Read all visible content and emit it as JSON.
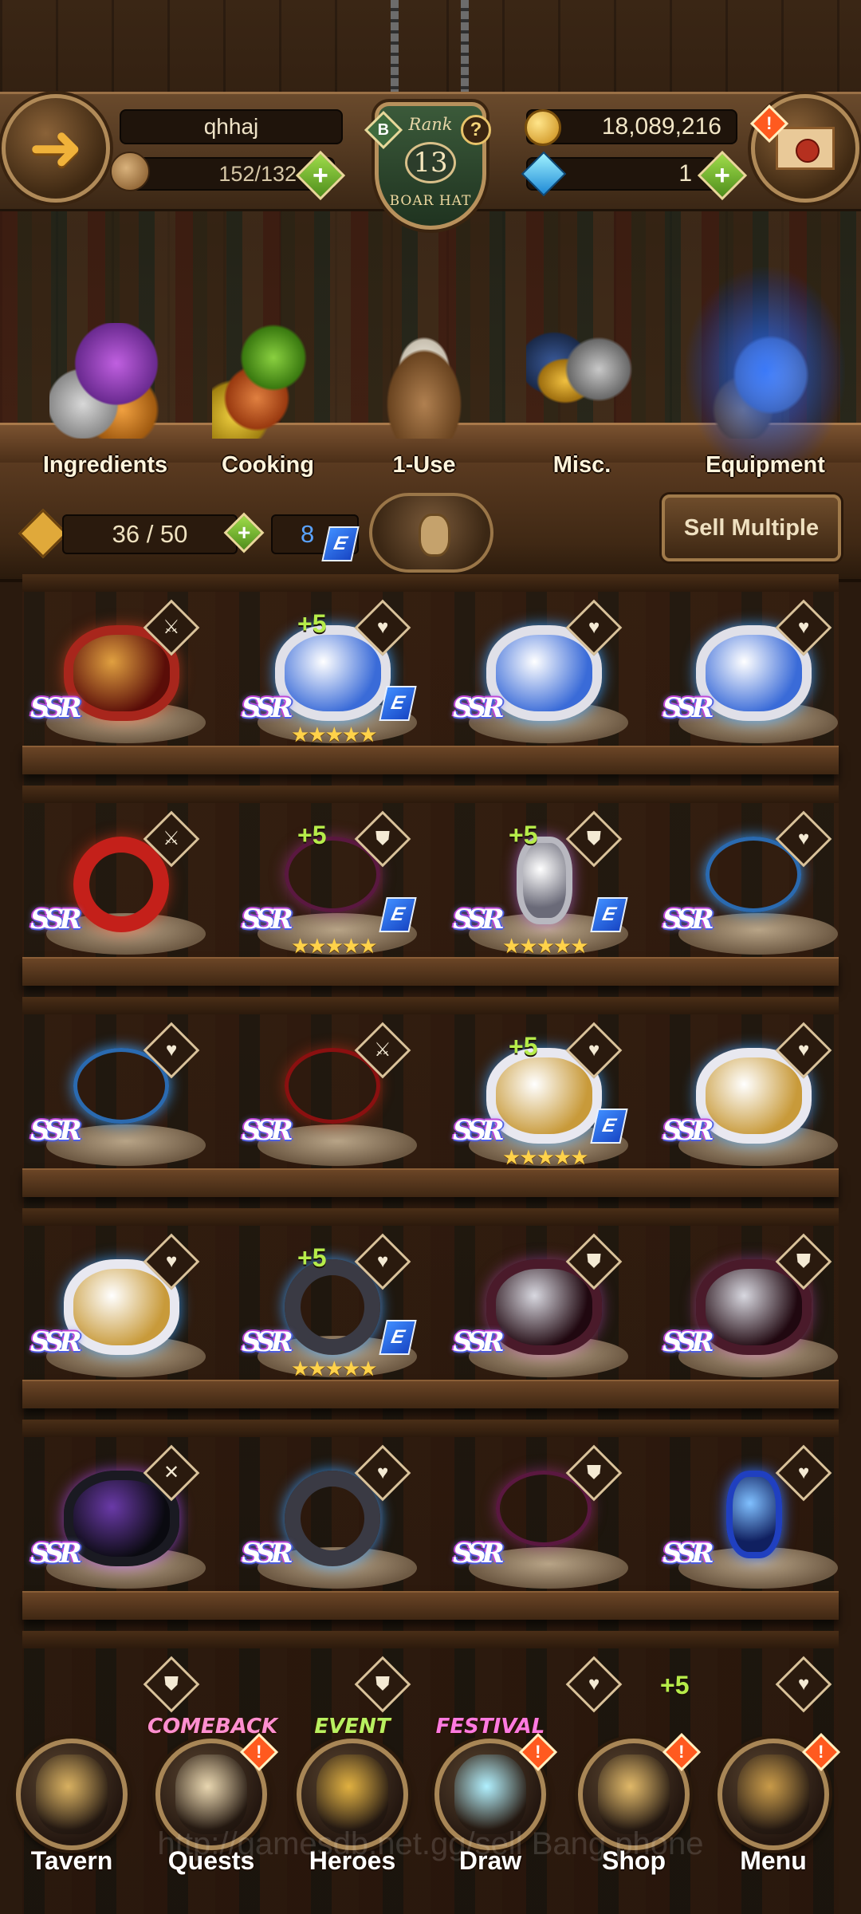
{
  "hud": {
    "player_name": "qhhaj",
    "stamina": "152/132",
    "rank_label": "Rank",
    "rank_number": "13",
    "rank_title": "BOAR HAT",
    "rank_badge_letter": "B",
    "help_symbol": "?",
    "gold": "18,089,216",
    "gems": "1",
    "alert_symbol": "!"
  },
  "categories": [
    {
      "label": "Ingredients",
      "icon": "ingredients-icon",
      "active": false
    },
    {
      "label": "Cooking",
      "icon": "cooking-icon",
      "active": false
    },
    {
      "label": "1-Use",
      "icon": "one-use-bag-icon",
      "active": false
    },
    {
      "label": "Misc.",
      "icon": "misc-trophy-icon",
      "active": false
    },
    {
      "label": "Equipment",
      "icon": "equipment-armor-icon",
      "active": true
    }
  ],
  "inventory": {
    "count": "36 / 50",
    "equipped_count": "8",
    "equipped_tag": "E",
    "sell_label": "Sell Multiple"
  },
  "items": [
    {
      "rarity": "SSR",
      "lock": "sword",
      "plus": "",
      "stars": "",
      "equipped": false,
      "kind": "bracelet",
      "c1": "#a8261c",
      "c2": "#e0a040",
      "c3": "#5a0d08",
      "glow": "rgba(255,80,40,0.5)"
    },
    {
      "rarity": "SSR",
      "lock": "heart",
      "plus": "+5",
      "stars": "★★★★★",
      "equipped": true,
      "kind": "bracelet",
      "c1": "#e0e0e8",
      "c2": "#ffffff",
      "c3": "#3a6bd8",
      "glow": "rgba(60,160,255,0.9)"
    },
    {
      "rarity": "SSR",
      "lock": "heart",
      "plus": "",
      "stars": "",
      "equipped": false,
      "kind": "bracelet",
      "c1": "#e0e0e8",
      "c2": "#ffffff",
      "c3": "#3a6bd8",
      "glow": "rgba(60,160,255,0.9)"
    },
    {
      "rarity": "SSR",
      "lock": "heart",
      "plus": "",
      "stars": "",
      "equipped": false,
      "kind": "bracelet",
      "c1": "#e0e0e8",
      "c2": "#ffffff",
      "c3": "#3a6bd8",
      "glow": "rgba(60,160,255,0.9)"
    },
    {
      "rarity": "SSR",
      "lock": "sword",
      "plus": "",
      "stars": "",
      "equipped": false,
      "kind": "ring",
      "c1": "#c4201a",
      "c2": "#ffcc40",
      "c3": "#200000",
      "glow": "rgba(255,60,30,0.5)"
    },
    {
      "rarity": "SSR",
      "lock": "shield",
      "plus": "+5",
      "stars": "★★★★★",
      "equipped": true,
      "kind": "necklace",
      "c1": "#5a1840",
      "c2": "#c0c0c8",
      "c3": "#5a1840",
      "glow": "rgba(180,60,160,0.5)"
    },
    {
      "rarity": "SSR",
      "lock": "shield",
      "plus": "+5",
      "stars": "★★★★★",
      "equipped": true,
      "kind": "earring",
      "c1": "#b8b8c0",
      "c2": "#ffffff",
      "c3": "#6a6a78",
      "glow": "rgba(200,120,255,0.6)"
    },
    {
      "rarity": "SSR",
      "lock": "heart",
      "plus": "",
      "stars": "",
      "equipped": false,
      "kind": "necklace",
      "c1": "#2a6ab0",
      "c2": "#ffd060",
      "c3": "#2a6ab0",
      "glow": "rgba(60,160,255,0.9)"
    },
    {
      "rarity": "SSR",
      "lock": "heart",
      "plus": "",
      "stars": "",
      "equipped": false,
      "kind": "necklace",
      "c1": "#2a6ab0",
      "c2": "#ffd060",
      "c3": "#2a6ab0",
      "glow": "rgba(60,160,255,0.9)"
    },
    {
      "rarity": "SSR",
      "lock": "sword",
      "plus": "",
      "stars": "",
      "equipped": false,
      "kind": "necklace",
      "c1": "#8a1010",
      "c2": "#ffb030",
      "c3": "#8a1010",
      "glow": "rgba(255,60,30,0.4)"
    },
    {
      "rarity": "SSR",
      "lock": "heart",
      "plus": "+5",
      "stars": "★★★★★",
      "equipped": true,
      "kind": "bracelet",
      "c1": "#e8e8f0",
      "c2": "#ffffff",
      "c3": "#c89a3a",
      "glow": "rgba(60,160,255,0.8)"
    },
    {
      "rarity": "SSR",
      "lock": "heart",
      "plus": "",
      "stars": "",
      "equipped": false,
      "kind": "bracelet",
      "c1": "#e8e8f0",
      "c2": "#ffffff",
      "c3": "#c89a3a",
      "glow": "rgba(60,160,255,0.8)"
    },
    {
      "rarity": "SSR",
      "lock": "heart",
      "plus": "",
      "stars": "",
      "equipped": false,
      "kind": "bracelet",
      "c1": "#e8e8f0",
      "c2": "#ffffff",
      "c3": "#c89a3a",
      "glow": "rgba(60,160,255,0.8)"
    },
    {
      "rarity": "SSR",
      "lock": "heart",
      "plus": "+5",
      "stars": "★★★★★",
      "equipped": true,
      "kind": "ring",
      "c1": "#3a3a44",
      "c2": "#3070ff",
      "c3": "#101018",
      "glow": "rgba(60,160,255,0.9)"
    },
    {
      "rarity": "SSR",
      "lock": "shield",
      "plus": "",
      "stars": "",
      "equipped": false,
      "kind": "bracelet",
      "c1": "#4a1a2a",
      "c2": "#d8d8e0",
      "c3": "#200810",
      "glow": "rgba(200,80,200,0.5)"
    },
    {
      "rarity": "SSR",
      "lock": "shield",
      "plus": "",
      "stars": "",
      "equipped": false,
      "kind": "bracelet",
      "c1": "#4a1a2a",
      "c2": "#d8d8e0",
      "c3": "#200810",
      "glow": "rgba(200,80,200,0.5)"
    },
    {
      "rarity": "SSR",
      "lock": "cross",
      "plus": "",
      "stars": "",
      "equipped": false,
      "kind": "bracelet",
      "c1": "#1a1a22",
      "c2": "#6a3aa8",
      "c3": "#0a0a10",
      "glow": "rgba(180,80,255,0.7)"
    },
    {
      "rarity": "SSR",
      "lock": "heart",
      "plus": "",
      "stars": "",
      "equipped": false,
      "kind": "ring",
      "c1": "#3a3a44",
      "c2": "#3070ff",
      "c3": "#101018",
      "glow": "rgba(60,160,255,0.9)"
    },
    {
      "rarity": "SSR",
      "lock": "shield",
      "plus": "",
      "stars": "",
      "equipped": false,
      "kind": "necklace",
      "c1": "#5a1840",
      "c2": "#c0c0c8",
      "c3": "#5a1840",
      "glow": "rgba(180,60,160,0.5)"
    },
    {
      "rarity": "SSR",
      "lock": "heart",
      "plus": "",
      "stars": "",
      "equipped": false,
      "kind": "earring",
      "c1": "#2040c0",
      "c2": "#80c0ff",
      "c3": "#102060",
      "glow": "rgba(60,120,255,0.9)"
    }
  ],
  "partial_row": [
    {
      "lock": "shield",
      "plus": ""
    },
    {
      "lock": "shield",
      "plus": ""
    },
    {
      "lock": "heart",
      "plus": ""
    },
    {
      "lock": "heart",
      "plus": "+5"
    }
  ],
  "nav": [
    {
      "label": "Tavern",
      "banner": "",
      "icon": "tavern-pig-icon",
      "alert": false,
      "color": "#d8b060"
    },
    {
      "label": "Quests",
      "banner": "COMEBACK",
      "icon": "quest-scroll-icon",
      "alert": true,
      "color": "#e8d6b0"
    },
    {
      "label": "Heroes",
      "banner": "EVENT",
      "icon": "hero-helmet-icon",
      "alert": false,
      "color": "#e0b040"
    },
    {
      "label": "Draw",
      "banner": "FESTIVAL",
      "icon": "draw-crystal-icon",
      "alert": true,
      "color": "#b0f0ff"
    },
    {
      "label": "Shop",
      "banner": "",
      "icon": "shop-sign-icon",
      "alert": true,
      "color": "#e0b868"
    },
    {
      "label": "Menu",
      "banner": "",
      "icon": "menu-gear-icon",
      "alert": true,
      "color": "#c89a48"
    }
  ],
  "watermark": "http://gamesdb.net.gg/sell Bang.phone"
}
